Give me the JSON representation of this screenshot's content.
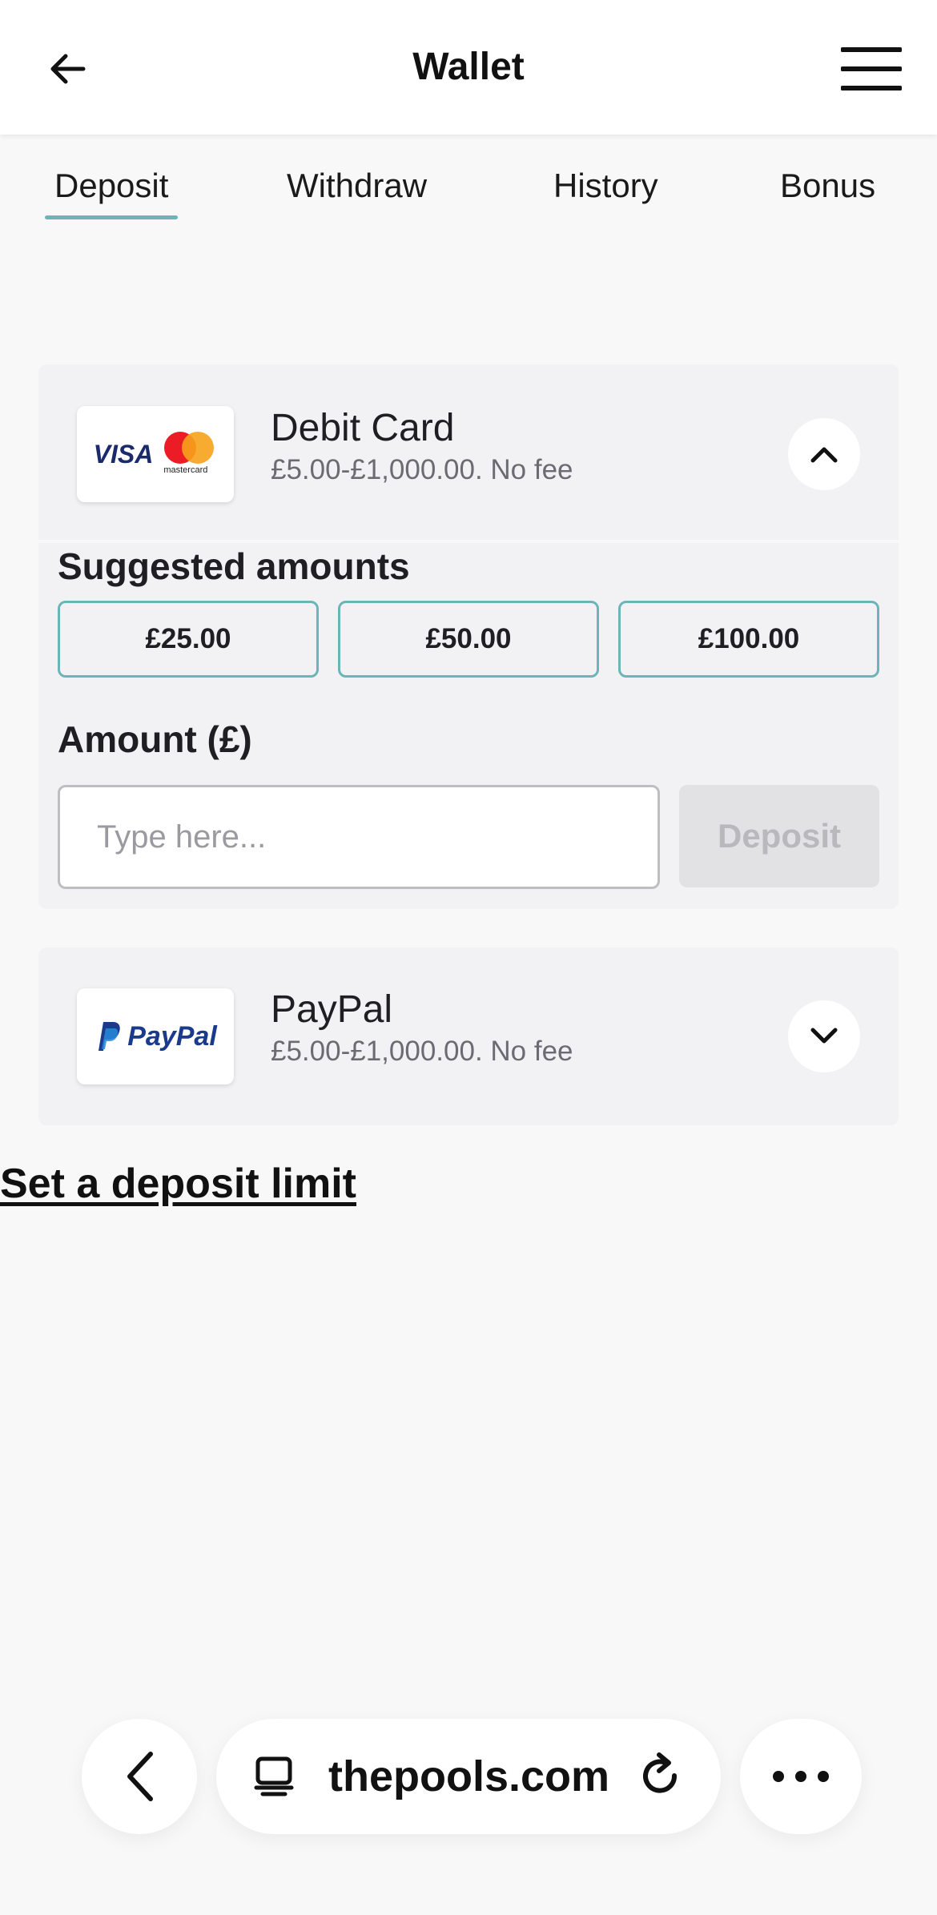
{
  "header": {
    "title": "Wallet",
    "back_icon": "back-arrow-icon",
    "menu_icon": "hamburger-menu-icon"
  },
  "tabs": [
    {
      "label": "Deposit",
      "active": true
    },
    {
      "label": "Withdraw",
      "active": false
    },
    {
      "label": "History",
      "active": false
    },
    {
      "label": "Bonus",
      "active": false
    }
  ],
  "methods": {
    "debit": {
      "name": "Debit Card",
      "subtitle": "£5.00-£1,000.00. No fee",
      "logo_visa": "VISA",
      "logo_mastercard": "mastercard",
      "expanded": true,
      "toggle_icon": "chevron-up-icon"
    },
    "paypal": {
      "name": "PayPal",
      "subtitle": "£5.00-£1,000.00. No fee",
      "logo_text": "PayPal",
      "expanded": false,
      "toggle_icon": "chevron-down-icon"
    }
  },
  "deposit_form": {
    "suggested_label": "Suggested amounts",
    "suggested": [
      "£25.00",
      "£50.00",
      "£100.00"
    ],
    "amount_label": "Amount (£)",
    "amount_placeholder": "Type here...",
    "amount_value": "",
    "deposit_button": "Deposit"
  },
  "limit_link": "Set a deposit limit",
  "browser": {
    "url": "thepools.com",
    "back_icon": "chevron-left-icon",
    "tab_icon": "tabs-icon",
    "reload_icon": "reload-icon",
    "more_icon": "more-dots-icon"
  },
  "colors": {
    "accent": "#6cb4b8",
    "card_bg": "#f2f2f4",
    "page_bg": "#f8f8f9"
  }
}
